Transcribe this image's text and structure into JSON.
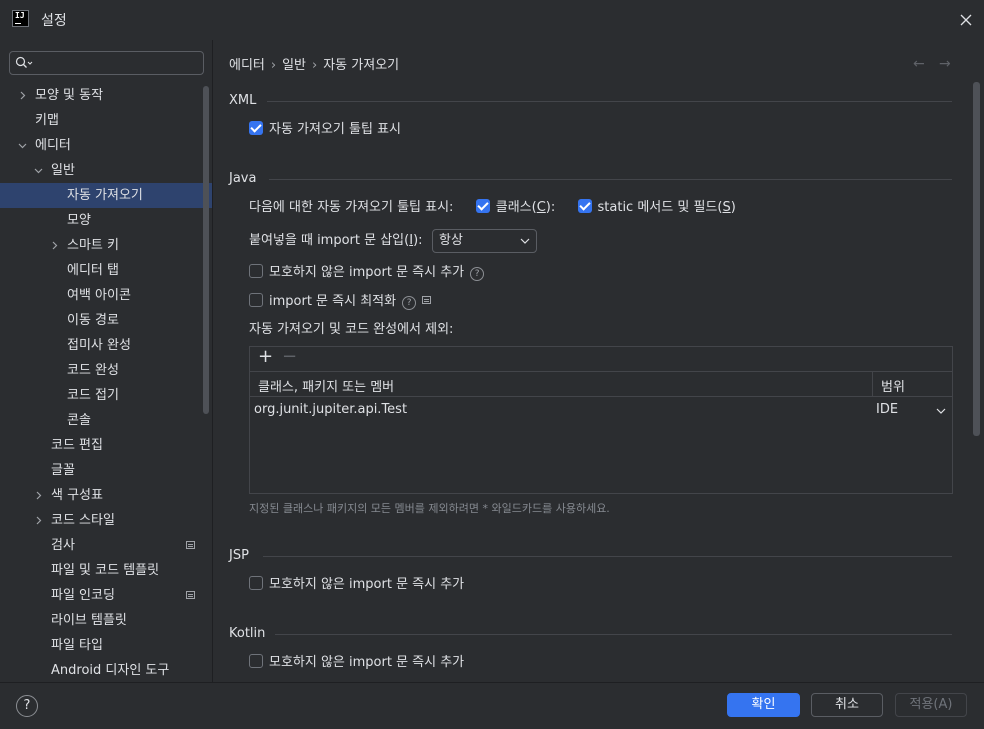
{
  "window": {
    "title": "설정",
    "logo_text": "IJ"
  },
  "search": {
    "placeholder": ""
  },
  "sidebar": {
    "items": [
      {
        "label": "모양 및 동작",
        "level": 0,
        "arrow": "right"
      },
      {
        "label": "키맵",
        "level": 0,
        "arrow": "none"
      },
      {
        "label": "에디터",
        "level": 0,
        "arrow": "down"
      },
      {
        "label": "일반",
        "level": 1,
        "arrow": "down"
      },
      {
        "label": "자동 가져오기",
        "level": 2,
        "arrow": "none",
        "selected": true
      },
      {
        "label": "모양",
        "level": 2,
        "arrow": "none"
      },
      {
        "label": "스마트 키",
        "level": 2,
        "arrow": "right"
      },
      {
        "label": "에디터 탭",
        "level": 2,
        "arrow": "none"
      },
      {
        "label": "여백 아이콘",
        "level": 2,
        "arrow": "none"
      },
      {
        "label": "이동 경로",
        "level": 2,
        "arrow": "none"
      },
      {
        "label": "접미사 완성",
        "level": 2,
        "arrow": "none"
      },
      {
        "label": "코드 완성",
        "level": 2,
        "arrow": "none"
      },
      {
        "label": "코드 접기",
        "level": 2,
        "arrow": "none"
      },
      {
        "label": "콘솔",
        "level": 2,
        "arrow": "none"
      },
      {
        "label": "코드 편집",
        "level": 1,
        "arrow": "none"
      },
      {
        "label": "글꼴",
        "level": 1,
        "arrow": "none"
      },
      {
        "label": "색 구성표",
        "level": 1,
        "arrow": "right"
      },
      {
        "label": "코드 스타일",
        "level": 1,
        "arrow": "right"
      },
      {
        "label": "검사",
        "level": 1,
        "arrow": "none",
        "badge": true
      },
      {
        "label": "파일 및 코드 템플릿",
        "level": 1,
        "arrow": "none"
      },
      {
        "label": "파일 인코딩",
        "level": 1,
        "arrow": "none",
        "badge": true
      },
      {
        "label": "라이브 템플릿",
        "level": 1,
        "arrow": "none"
      },
      {
        "label": "파일 타입",
        "level": 1,
        "arrow": "none"
      },
      {
        "label": "Android 디자인 도구",
        "level": 1,
        "arrow": "none"
      }
    ]
  },
  "breadcrumb": {
    "part1": "에디터",
    "part2": "일반",
    "part3": "자동 가져오기",
    "sep": "›"
  },
  "xml": {
    "title": "XML",
    "show_popup_label": "자동 가져오기 툴팁 표시",
    "show_popup_checked": true
  },
  "java": {
    "title": "Java",
    "popup_prefix": "다음에 대한 자동 가져오기 툴팁 표시:",
    "classes_label": "클래스",
    "classes_mnemonic": "C",
    "classes_checked": true,
    "static_label": "static 메서드 및 필드",
    "static_mnemonic": "S",
    "static_checked": true,
    "insert_label": "붙여넣을 때 import 문 삽입",
    "insert_mnemonic": "I",
    "insert_value": "항상",
    "add_unambiguous_label": "모호하지 않은 import 문 즉시 추가",
    "add_unambiguous_checked": false,
    "optimize_label": "import 문 즉시 최적화",
    "optimize_checked": false,
    "exclude_label": "자동 가져오기 및 코드 완성에서 제외:",
    "table": {
      "add_icon": "+",
      "remove_icon": "−",
      "col_name": "클래스, 패키지 또는 멤버",
      "col_scope": "범위",
      "rows": [
        {
          "name": "org.junit.jupiter.api.Test",
          "scope": "IDE"
        }
      ]
    },
    "hint": "지정된 클래스나 패키지의 모든 멤버를 제외하려면 * 와일드카드를 사용하세요."
  },
  "jsp": {
    "title": "JSP",
    "add_unambiguous_label": "모호하지 않은 import 문 즉시 추가",
    "add_unambiguous_checked": false
  },
  "kotlin": {
    "title": "Kotlin",
    "add_unambiguous_label": "모호하지 않은 import 문 즉시 추가",
    "add_unambiguous_checked": false
  },
  "footer": {
    "help": "?",
    "ok": "확인",
    "cancel": "취소",
    "apply": "적용(A)"
  },
  "colors": {
    "accent": "#3574f0",
    "background": "#2b2d30",
    "selection": "#2e436e"
  }
}
